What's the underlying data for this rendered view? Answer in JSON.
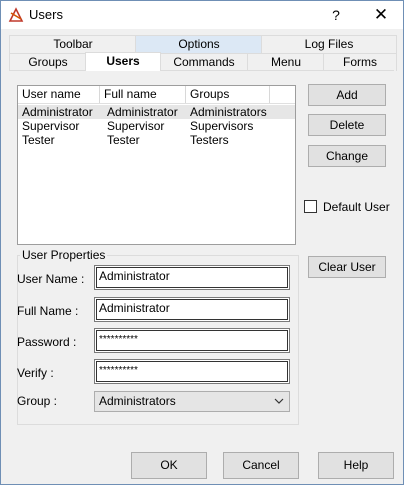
{
  "window": {
    "title": "Users",
    "help_glyph": "?",
    "close_glyph": "✕"
  },
  "tabs": {
    "row_top": [
      "Toolbar",
      "Options",
      "Log Files"
    ],
    "row_bottom": [
      "Groups",
      "Users",
      "Commands",
      "Menu",
      "Forms"
    ],
    "active": "Users",
    "highlighted": "Options"
  },
  "users_list": {
    "columns": [
      "User name",
      "Full name",
      "Groups"
    ],
    "rows": [
      [
        "Administrator",
        "Administrator",
        "Administrators"
      ],
      [
        "Supervisor",
        "Supervisor",
        "Supervisors"
      ],
      [
        "Tester",
        "Tester",
        "Testers"
      ]
    ],
    "selected_row": 0
  },
  "buttons": {
    "add": "Add",
    "delete": "Delete",
    "change": "Change",
    "clear_user": "Clear User",
    "ok": "OK",
    "cancel": "Cancel",
    "help": "Help"
  },
  "default_user": {
    "label": "Default User",
    "checked": false
  },
  "user_properties": {
    "title": "User Properties",
    "user_name_label": "User Name :",
    "user_name_value": "Administrator",
    "full_name_label": "Full Name :",
    "full_name_value": "Administrator",
    "password_label": "Password :",
    "password_value": "**********",
    "verify_label": "Verify :",
    "verify_value": "**********",
    "group_label": "Group :",
    "group_value": "Administrators"
  },
  "icons": {
    "app": "app-logo-icon",
    "dropdown": "chevron-down-icon",
    "close": "close-icon",
    "help": "help-icon"
  }
}
